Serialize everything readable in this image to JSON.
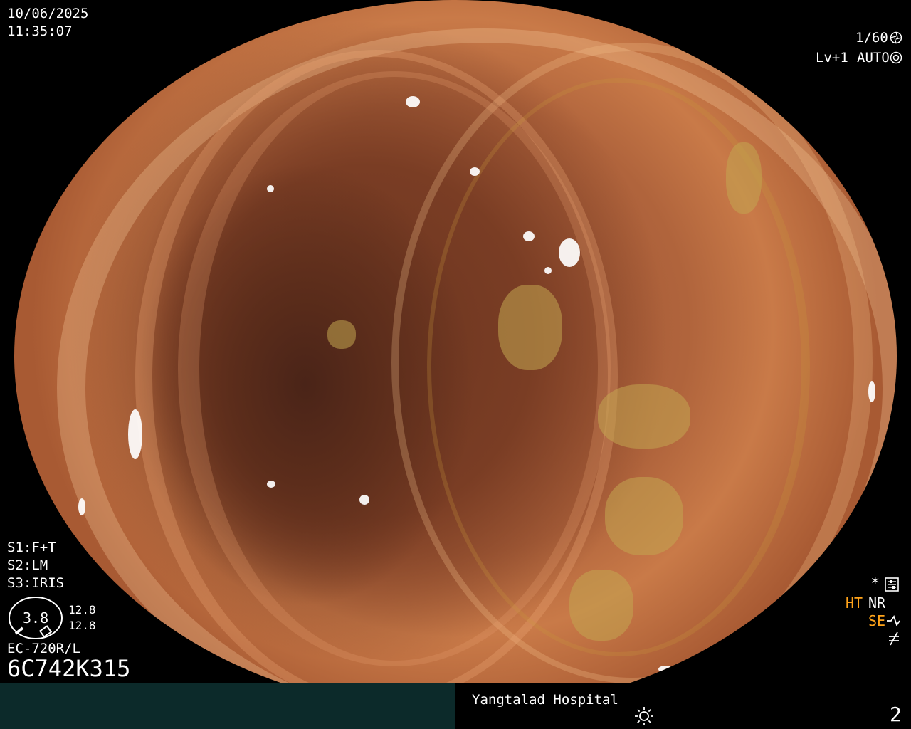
{
  "overlay": {
    "date": "10/06/2025",
    "time": "11:35:07",
    "shutter": "1/60",
    "level": "Lv+1",
    "mode": "AUTO",
    "s1_prefix": "S1:",
    "s1_value": "F+T",
    "s2_prefix": "S2:",
    "s2_value": "LM",
    "s3_prefix": "S3:",
    "s3_value": "IRIS",
    "gauge_value": "3.8",
    "gauge_upper": "12.8",
    "gauge_lower": "12.8",
    "scope_model": "EC-720R/L",
    "serial": "6C742K315",
    "star": "*",
    "ht": "HT",
    "nr": "NR",
    "se": "SE"
  },
  "footer": {
    "hospital": "Yangtalad Hospital",
    "page_number": "2"
  },
  "colors": {
    "amber": "#ffa31a",
    "footer_left": "#0c2a2a"
  },
  "icons": [
    "shutter-icon",
    "auto-exposure-icon",
    "settings-icon",
    "scope-tip-icon",
    "flash-off-icon",
    "brightness-icon"
  ]
}
